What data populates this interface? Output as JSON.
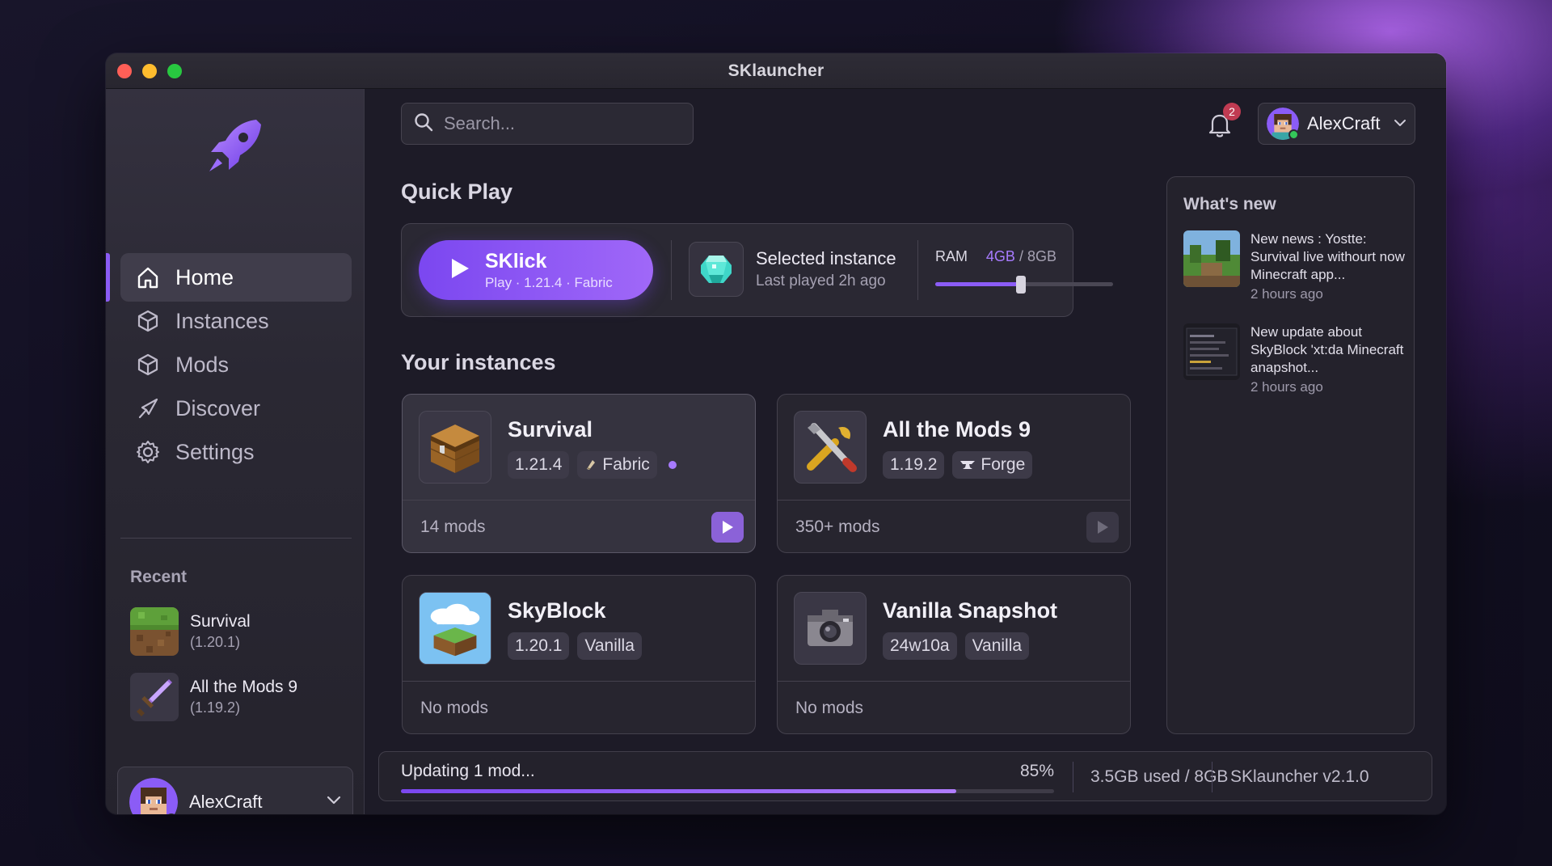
{
  "window": {
    "title": "SKlauncher"
  },
  "sidebar": {
    "items": [
      {
        "label": "Home",
        "icon": "home-icon",
        "active": true
      },
      {
        "label": "Instances",
        "icon": "cube-icon"
      },
      {
        "label": "Mods",
        "icon": "cube-icon"
      },
      {
        "label": "Discover",
        "icon": "compass-icon"
      },
      {
        "label": "Settings",
        "icon": "gear-icon"
      }
    ],
    "recent_title": "Recent",
    "recent": [
      {
        "name": "Survival",
        "version": "(1.20.1)",
        "icon": "grass-block-icon"
      },
      {
        "name": "All the Mods 9",
        "version": "(1.19.2)",
        "icon": "sword-icon"
      }
    ],
    "user": {
      "name": "AlexCraft",
      "status": "online"
    }
  },
  "topbar": {
    "search_placeholder": "Search...",
    "notifications": "2",
    "user": {
      "name": "AlexCraft"
    }
  },
  "quick_play": {
    "title": "Quick Play",
    "play_button": {
      "title": "SKlick",
      "subtitle": "Play · 1.21.4 · Fabric"
    },
    "selected": {
      "title": "Selected instance",
      "subtitle": "Last played 2h ago"
    },
    "ram": {
      "label": "RAM",
      "value": "4GB",
      "total": "/ 8GB",
      "fraction": 0.48
    }
  },
  "instances": {
    "title": "Your instances",
    "items": [
      {
        "name": "Survival",
        "version": "1.21.4",
        "loader": "Fabric",
        "loader_icon": "fabric-icon",
        "mods": "14 mods",
        "icon": "chest-icon",
        "selected": true,
        "play_enabled": true
      },
      {
        "name": "All the Mods 9",
        "version": "1.19.2",
        "loader": "Forge",
        "loader_icon": "anvil-icon",
        "mods": "350+ mods",
        "icon": "tools-icon",
        "selected": false,
        "play_enabled": false
      },
      {
        "name": "SkyBlock",
        "version": "1.20.1",
        "loader": "Vanilla",
        "mods": "No mods",
        "icon": "skyblock-icon"
      },
      {
        "name": "Vanilla Snapshot",
        "version": "24w10a",
        "loader": "Vanilla",
        "mods": "No mods",
        "icon": "camera-icon"
      }
    ]
  },
  "news": {
    "title": "What's new",
    "items": [
      {
        "text": "New news : Yostte: Survival live withourt now Minecraft app...",
        "time": "2 hours ago"
      },
      {
        "text": "New update about SkyBlock 'xt:da Minecraft anapshot...",
        "time": "2 hours ago"
      }
    ]
  },
  "status": {
    "text": "Updating 1 mod...",
    "percent": "85%",
    "progress": 0.85,
    "memory": "3.5GB used / 8GB",
    "version": "SKlauncher v2.1.0"
  },
  "colors": {
    "accent": "#8b5cf6",
    "online": "#34c759",
    "badge": "#c03b52"
  }
}
